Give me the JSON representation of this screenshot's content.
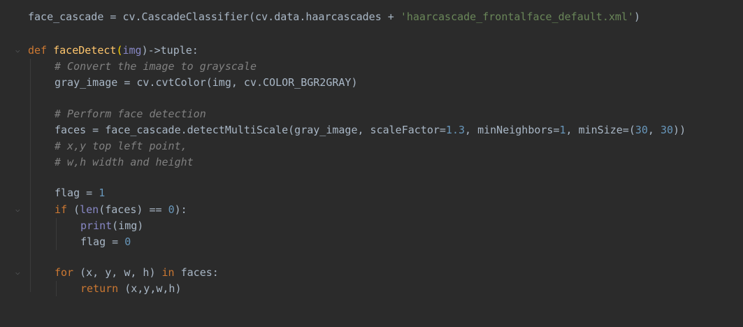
{
  "code": {
    "lines": [
      {
        "id": "l1",
        "tokens": [
          "face_cascade = cv.CascadeClassifier(cv.data.haarcascades + ",
          "'haarcascade_frontalface_default.xml'",
          ")"
        ]
      },
      {
        "id": "l2",
        "tokens": [
          "def",
          " ",
          "faceDetect",
          "(",
          "img",
          ")->tuple:"
        ]
      },
      {
        "id": "l3",
        "tokens": [
          "# Convert the image to grayscale"
        ]
      },
      {
        "id": "l4",
        "tokens": [
          "gray_image = cv.cvtColor(img, cv.COLOR_BGR2GRAY)"
        ]
      },
      {
        "id": "l5",
        "tokens": [
          "# Perform face detection"
        ]
      },
      {
        "id": "l6",
        "tokens": [
          "faces = face_cascade.detectMultiScale(gray_image, scaleFactor=",
          "1.3",
          ", minNeighbors=",
          "1",
          ", minSize=(",
          "30",
          ", ",
          "30",
          "))"
        ]
      },
      {
        "id": "l7",
        "tokens": [
          "# x,y top left point,"
        ]
      },
      {
        "id": "l8",
        "tokens": [
          "# w,h width and height"
        ]
      },
      {
        "id": "l9",
        "tokens": [
          "flag = ",
          "1"
        ]
      },
      {
        "id": "l10",
        "tokens": [
          "if",
          " (",
          "len",
          "(faces) == ",
          "0",
          "):"
        ]
      },
      {
        "id": "l11",
        "tokens": [
          "print",
          "(img)"
        ]
      },
      {
        "id": "l12",
        "tokens": [
          "flag = ",
          "0"
        ]
      },
      {
        "id": "l13",
        "tokens": [
          "for",
          " (x, y, w, h) ",
          "in",
          " faces:"
        ]
      },
      {
        "id": "l14",
        "tokens": [
          "return",
          " (x,y,w,h)"
        ]
      }
    ]
  },
  "colors": {
    "background": "#2b2b2b",
    "keyword": "#cc7832",
    "function": "#ffc66d",
    "comment": "#808080",
    "string": "#6a8759",
    "number": "#6897bb",
    "builtin": "#8888c6",
    "plain": "#a9b7c6"
  },
  "icons": [
    "fold-chevron-icon"
  ]
}
